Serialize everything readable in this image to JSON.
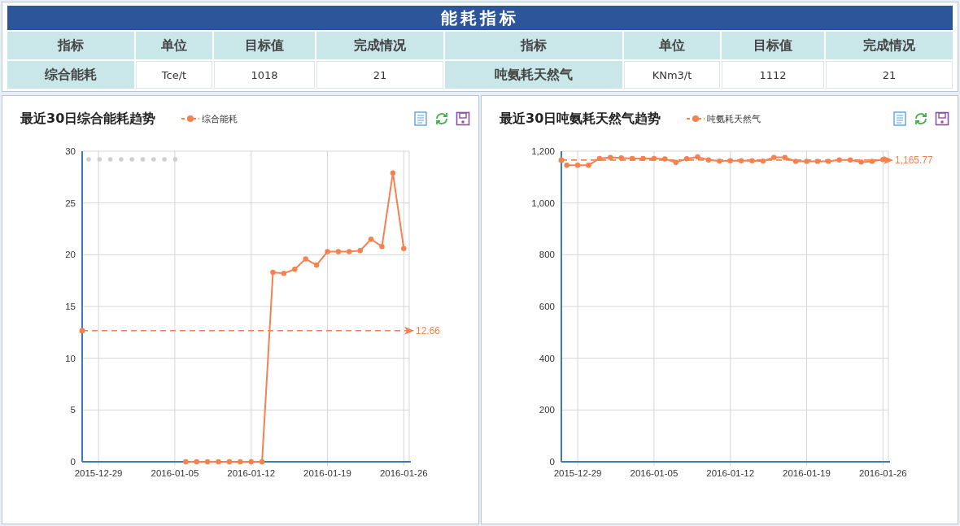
{
  "header": {
    "title": "能耗指标"
  },
  "table": {
    "columns": [
      "指标",
      "单位",
      "目标值",
      "完成情况",
      "指标",
      "单位",
      "目标值",
      "完成情况"
    ],
    "rows": [
      [
        {
          "text": "综合能耗",
          "kind": "label"
        },
        {
          "text": "Tce/t",
          "kind": "value"
        },
        {
          "text": "1018",
          "kind": "value"
        },
        {
          "text": "21",
          "kind": "value"
        },
        {
          "text": "吨氨耗天然气",
          "kind": "label"
        },
        {
          "text": "KNm3/t",
          "kind": "value"
        },
        {
          "text": "1112",
          "kind": "value"
        },
        {
          "text": "21",
          "kind": "value"
        }
      ]
    ]
  },
  "charts": [
    {
      "chart_data": {
        "type": "line",
        "title": "最近30日综合能耗趋势",
        "categories": [
          null,
          "2015-12-29",
          null,
          null,
          null,
          null,
          null,
          null,
          "2016-01-05",
          null,
          null,
          null,
          null,
          null,
          null,
          "2016-01-12",
          null,
          null,
          null,
          null,
          null,
          null,
          "2016-01-19",
          null,
          null,
          null,
          null,
          null,
          null,
          "2016-01-26"
        ],
        "series": [
          {
            "name": "综合能耗",
            "color": "#f5814f",
            "marker": "circle",
            "values": [
              null,
              null,
              null,
              null,
              null,
              null,
              null,
              null,
              null,
              0,
              0,
              0,
              0,
              0,
              0,
              0,
              0,
              18.3,
              18.2,
              18.6,
              19.6,
              19.0,
              20.3,
              20.3,
              20.3,
              20.4,
              21.5,
              20.8,
              27.9,
              20.6
            ]
          }
        ],
        "ylim": [
          0,
          30
        ],
        "yticks": [
          {
            "value": 0,
            "label": "0"
          },
          {
            "value": 5,
            "label": "5"
          },
          {
            "value": 10,
            "label": "10"
          },
          {
            "value": 15,
            "label": "15"
          },
          {
            "value": 20,
            "label": "20"
          },
          {
            "value": 25,
            "label": "25"
          },
          {
            "value": 30,
            "label": "30"
          }
        ],
        "grid": true,
        "ref_lines": [
          {
            "axis": "y",
            "value": 12.66,
            "label": "12.66"
          }
        ]
      }
    },
    {
      "chart_data": {
        "type": "line",
        "title": "最近30日吨氨耗天然气趋势",
        "categories": [
          null,
          "2015-12-29",
          null,
          null,
          null,
          null,
          null,
          null,
          "2016-01-05",
          null,
          null,
          null,
          null,
          null,
          null,
          "2016-01-12",
          null,
          null,
          null,
          null,
          null,
          null,
          "2016-01-19",
          null,
          null,
          null,
          null,
          null,
          null,
          "2016-01-26"
        ],
        "series": [
          {
            "name": "吨氨耗天然气",
            "color": "#f5814f",
            "marker": "circle",
            "values": [
              1146,
              1146,
              1146,
              1172,
              1176,
              1174,
              1172,
              1172,
              1172,
              1170,
              1157,
              1171,
              1178,
              1166,
              1162,
              1163,
              1163,
              1163,
              1162,
              1176,
              1176,
              1161,
              1161,
              1161,
              1161,
              1166,
              1166,
              1158,
              1161,
              1168
            ]
          }
        ],
        "ylim": [
          0,
          1200
        ],
        "yticks": [
          {
            "value": 0,
            "label": "0"
          },
          {
            "value": 200,
            "label": "200"
          },
          {
            "value": 400,
            "label": "400"
          },
          {
            "value": 600,
            "label": "600"
          },
          {
            "value": 800,
            "label": "800"
          },
          {
            "value": 1000,
            "label": "1,000"
          },
          {
            "value": 1200,
            "label": "1,200"
          }
        ],
        "grid": true,
        "ref_lines": [
          {
            "axis": "y",
            "value": 1165.77,
            "label": "1,165.77"
          }
        ]
      }
    }
  ]
}
